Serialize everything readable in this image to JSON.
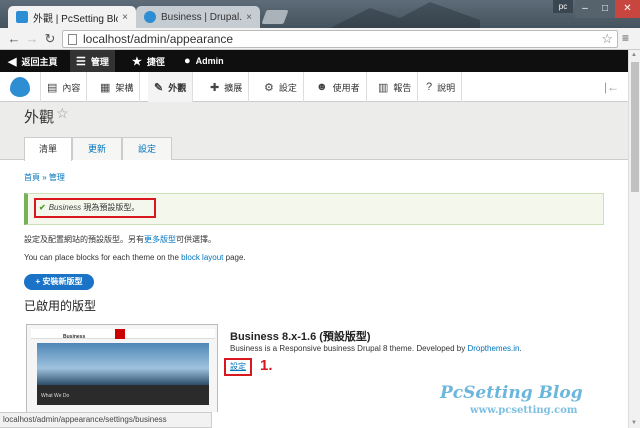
{
  "browser": {
    "tabs": [
      {
        "title": "外觀 | PcSetting Blog",
        "close": "×"
      },
      {
        "title": "Business | Drupal.org",
        "close": "×"
      }
    ],
    "user_badge": "pc",
    "window_buttons": {
      "minimize": "–",
      "maximize": "□",
      "close": "✕"
    },
    "url": "localhost/admin/appearance",
    "status_url": "localhost/admin/appearance/settings/business"
  },
  "admin_toolbar": {
    "back_label": "返回主頁",
    "manage_label": "管理",
    "shortcuts_label": "捷徑",
    "user_label": "Admin"
  },
  "admin_tray": {
    "items": [
      {
        "label": "內容",
        "icon": "content-icon"
      },
      {
        "label": "架構",
        "icon": "structure-icon"
      },
      {
        "label": "外觀",
        "icon": "appearance-icon"
      },
      {
        "label": "擴展",
        "icon": "extend-icon"
      },
      {
        "label": "設定",
        "icon": "config-icon"
      },
      {
        "label": "使用者",
        "icon": "people-icon"
      },
      {
        "label": "報告",
        "icon": "reports-icon"
      },
      {
        "label": "說明",
        "icon": "help-icon"
      }
    ]
  },
  "page": {
    "title": "外觀",
    "tabs": [
      "清單",
      "更新",
      "設定"
    ],
    "breadcrumb": "首頁 » 管理",
    "message": {
      "theme": "Business",
      "text": " 現為預設版型。"
    },
    "intro": {
      "before": "設定及配置網站的預設版型。另有",
      "link": "更多版型",
      "after": "可供選擇。"
    },
    "blocks_text": {
      "before": "You can place blocks for each theme on the ",
      "link": "block layout",
      "after": " page."
    },
    "install_button": "+ 安裝新版型",
    "section_heading": "已啟用的版型",
    "theme": {
      "name": "Business 8.x-1.6 (預設版型)",
      "desc_before": "Business is a Responsive business Drupal 8 theme. Developed by ",
      "desc_link": "Dropthemes.in",
      "desc_after": ".",
      "settings_link": "設定",
      "step_label": "1.",
      "screenshot_label": "Business",
      "screenshot_caption": "What We Do"
    }
  },
  "watermark": {
    "title": "PcSetting Blog",
    "url": "www.pcsetting.com"
  }
}
